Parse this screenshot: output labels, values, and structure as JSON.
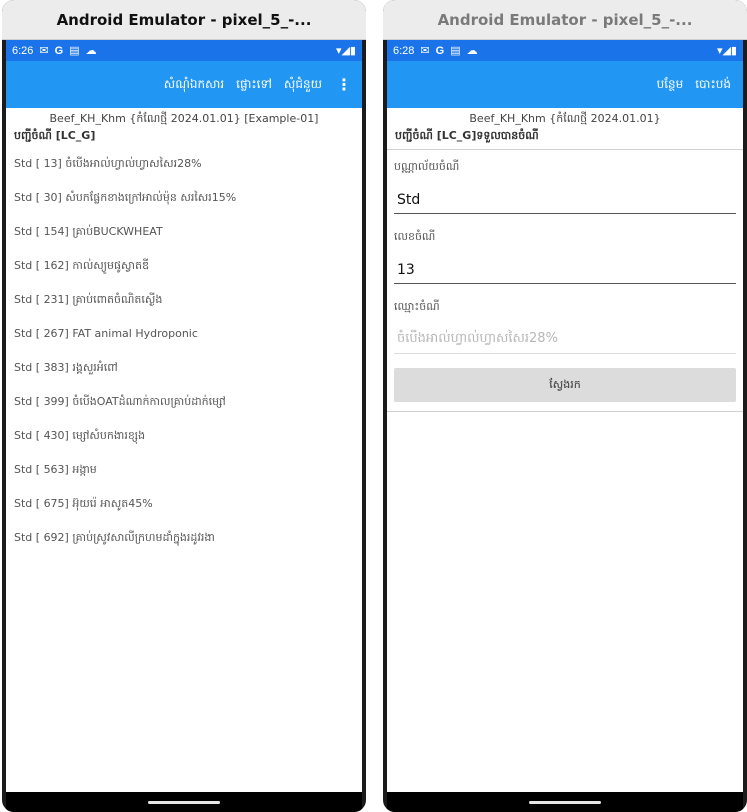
{
  "left": {
    "window_title": "Android Emulator - pixel_5_-...",
    "status": {
      "time": "6:26",
      "icons": [
        "gmail-icon",
        "google-icon",
        "calendar-icon",
        "cloud-icon"
      ],
      "right": "▾◢▮"
    },
    "appbar": {
      "actions": [
        "សំណុំឯកសារ",
        "ផ្លោះទៅ",
        "សុំជំនួយ"
      ],
      "menu": "⋮"
    },
    "subtitle": "Beef_KH_Khm {កំណែថ្មី 2024.01.01} [Example-01]",
    "list_title": "បញ្ជីចំណី [LC_G]",
    "items": [
      "Std [ 13] ចំបើងអាល់ហ្វាល់ហ្វាសសៃរ28%",
      "Std [ 30] សំបកផ្លែកខាងក្រៅអាល់ម៉ុន សរសៃរ15%",
      "Std [ 154] គ្រាប់BUCKWHEAT",
      "Std [ 162] កាល់ស្យូមផូស្វាតឌី",
      "Std [ 231] គ្រាប់ពោតចំណិតស្ងើង",
      "Std [ 267] FAT animal Hydroponic",
      "Std [ 383] រង្គសួរអំពៅ",
      "Std [ 399] ចំបើងOATដំណាក់កាលគ្រាប់ដាក់ម្សៅ",
      "Std [ 430] ម្សៅសំបកងារខ្សុង",
      "Std [ 563] អង្កាម",
      "Std [ 675] អ៊ុយរ៉េ អាសូត45%",
      "Std [ 692] គ្រាប់ស្រូវសាលីក្រហមដាំក្នុងរដូវរងា"
    ]
  },
  "right": {
    "window_title": "Android Emulator - pixel_5_-...",
    "status": {
      "time": "6:28",
      "icons": [
        "gmail-icon",
        "google-icon",
        "calendar-icon",
        "cloud-icon"
      ],
      "right": "▾◢▮"
    },
    "appbar": {
      "actions": [
        "បន្ថែម",
        "បោះបង់"
      ]
    },
    "subtitle": "Beef_KH_Khm {កំណែថ្មី 2024.01.01}",
    "list_title": "បញ្ជីចំណី [LC_G]ទទួលបានចំណី",
    "form": {
      "library_label": "បណ្ណាល័យចំណី",
      "library_value": "Std",
      "number_label": "លេខចំណី",
      "number_value": "13",
      "name_label": "ឈ្មោះចំណី",
      "name_placeholder": "ចំបើងអាល់ហ្វាល់ហ្វាសសៃរ28%",
      "search_button": "ស្វែងរក"
    }
  },
  "colors": {
    "status_bar": "#1a73e8",
    "app_bar": "#2196f3",
    "button": "#dcdcdc"
  }
}
